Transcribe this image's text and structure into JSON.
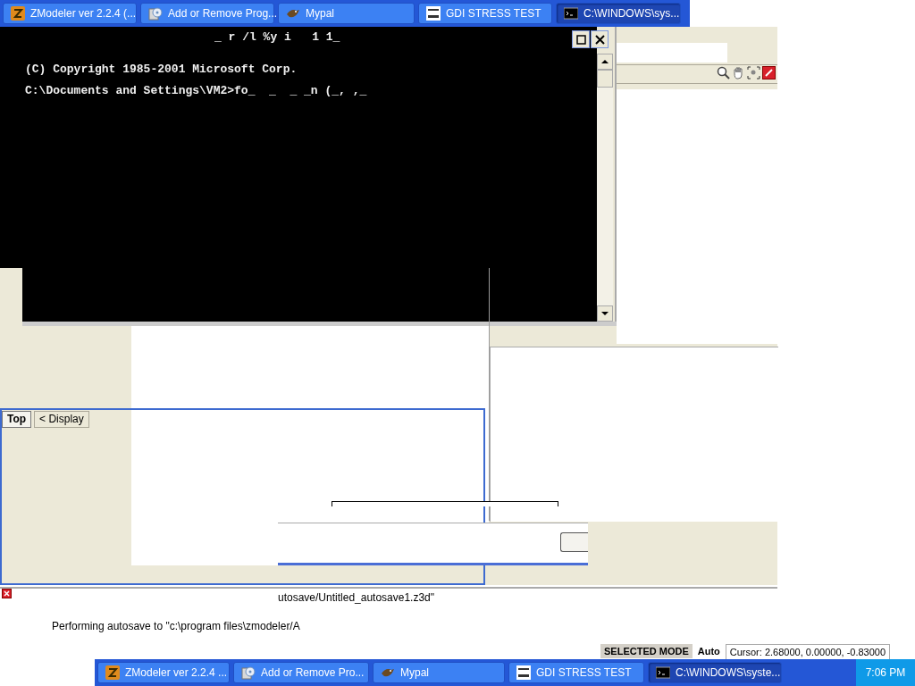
{
  "top_taskbar": {
    "buttons": [
      {
        "label": "ZModeler ver 2.2.4 (...",
        "kind": "zmodeler",
        "selected": false
      },
      {
        "label": "Add or Remove Prog...",
        "kind": "installer",
        "selected": false
      },
      {
        "label": "Mypal",
        "kind": "mypal",
        "selected": false
      },
      {
        "label": "GDI STRESS TEST",
        "kind": "gdi",
        "selected": false
      },
      {
        "label": "C:\\WINDOWS\\sys...",
        "kind": "console",
        "selected": true
      }
    ]
  },
  "console": {
    "title": "_ r /l %y i   1 1_",
    "lines": [
      "(C) Copyright 1985-2001 Microsoft Corp.",
      "C:\\Documents and Settings\\VM2>fo_  _  _ _n (_, ,_"
    ]
  },
  "view_tabs": [
    {
      "label": "Top",
      "selected": true
    },
    {
      "label": "< Display",
      "selected": false
    }
  ],
  "log": {
    "entries": [
      "utosave/Untitled_autosave1.z3d\"",
      "Performing autosave to \"c:\\program files\\zmodeler/A"
    ]
  },
  "status_bar": {
    "mode": "SELECTED MODE",
    "snap": "Auto",
    "cursor": "Cursor: 2.68000, 0.00000, -0.83000"
  },
  "taskbar": {
    "buttons": [
      {
        "label": "ZModeler ver 2.2.4 ...",
        "kind": "zmodeler",
        "selected": false
      },
      {
        "label": "Add or Remove Pro...",
        "kind": "installer",
        "selected": false
      },
      {
        "label": "Mypal",
        "kind": "mypal",
        "selected": false
      },
      {
        "label": "GDI STRESS TEST",
        "kind": "gdi",
        "selected": false
      },
      {
        "label": "C:\\WINDOWS\\syste...",
        "kind": "console",
        "selected": true
      }
    ],
    "clock": "7:06 PM"
  }
}
